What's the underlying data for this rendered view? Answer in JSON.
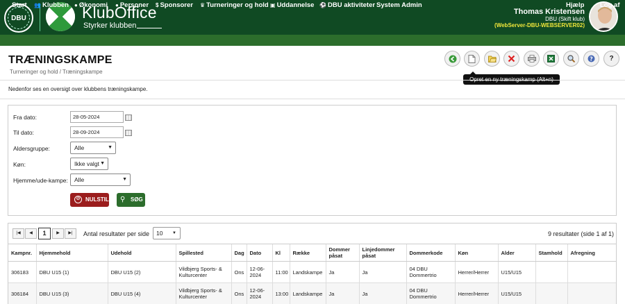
{
  "header": {
    "logo_text": "DBU",
    "app_title": "KlubOffice",
    "app_subtitle": "Styrker klubben",
    "user_name": "Thomas Kristensen",
    "user_club": "DBU (Skift klub)",
    "server": "(WebServer-DBU-WEBSERVER02)"
  },
  "nav": {
    "items": [
      {
        "label": "Start",
        "icon": ""
      },
      {
        "label": "Klubben",
        "icon": "people-icon"
      },
      {
        "label": "Økonomi",
        "icon": "coin-icon"
      },
      {
        "label": "Personer",
        "icon": "person-icon"
      },
      {
        "label": "Sponsorer",
        "icon": "money-icon"
      },
      {
        "label": "Turneringer og hold",
        "icon": "trophy-icon"
      },
      {
        "label": "Uddannelse",
        "icon": "book-icon"
      },
      {
        "label": "DBU aktiviteter",
        "icon": "ball-icon"
      },
      {
        "label": "System Admin",
        "icon": ""
      }
    ],
    "help": "Hjælp",
    "logout": "Log af"
  },
  "page": {
    "title": "TRÆNINGSKAMPE",
    "breadcrumb": "Turneringer og hold / Træningskampe",
    "info": "Nedenfor ses en oversigt over klubbens træningskampe.",
    "tooltip": "Opret en ny træningskamp (Alt+n)"
  },
  "toolbar": {
    "icons": [
      "back-icon",
      "new-document-icon",
      "open-folder-icon",
      "delete-icon",
      "print-icon",
      "excel-icon",
      "search-icon",
      "help-icon",
      "question-icon"
    ],
    "question_label": "?"
  },
  "filters": {
    "from_label": "Fra dato:",
    "from_value": "28-05-2024",
    "to_label": "Til dato:",
    "to_value": "28-09-2024",
    "age_label": "Aldersgruppe:",
    "age_value": "Alle",
    "gender_label": "Køn:",
    "gender_value": "Ikke valgt",
    "homeaway_label": "Hjemme/ude-kampe:",
    "homeaway_value": "Alle",
    "reset_label": "NULSTIL",
    "search_label": "SØG"
  },
  "results": {
    "current_page": "1",
    "per_page_label": "Antal resultater per side",
    "per_page_value": "10",
    "count_text": "9 resultater (side 1 af 1)",
    "columns": [
      "Kampnr.",
      "Hjemmehold",
      "Udehold",
      "Spillested",
      "Dag",
      "Dato",
      "Kl",
      "Række",
      "Dommer påsat",
      "Linjedommer påsat",
      "Dommerkode",
      "Køn",
      "Alder",
      "Stamhold",
      "Afregning"
    ],
    "rows": [
      [
        "306183",
        "DBU U15 (1)",
        "DBU U15 (2)",
        "Vildbjerg Sports- & Kulturcenter",
        "Ons",
        "12-06-2024",
        "11:00",
        "Landskampe",
        "Ja",
        "Ja",
        "04 DBU Dommertrio",
        "Herrer/Herrer",
        "U15/U15",
        "",
        ""
      ],
      [
        "306184",
        "DBU U15 (3)",
        "DBU U15 (4)",
        "Vildbjerg Sports- & Kulturcenter",
        "Ons",
        "12-06-2024",
        "13:00",
        "Landskampe",
        "Ja",
        "Ja",
        "04 DBU Dommertrio",
        "Herrer/Herrer",
        "U15/U15",
        "",
        ""
      ]
    ]
  }
}
